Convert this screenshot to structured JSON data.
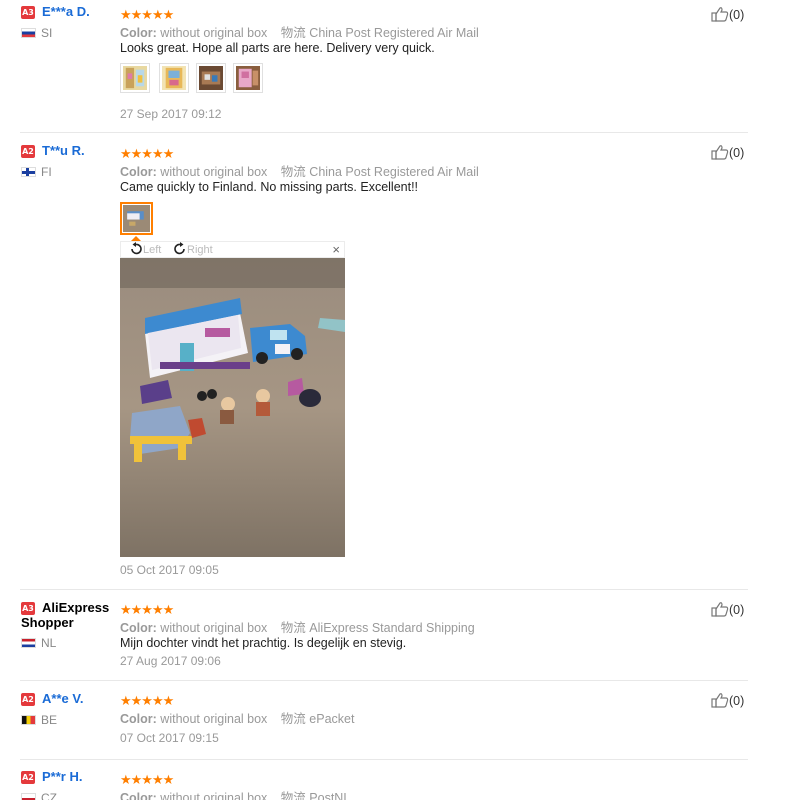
{
  "reviews": [
    {
      "level": "A3",
      "name": "E***a D.",
      "country": "SI",
      "stars": "★★★★★",
      "color_label": "Color:",
      "color_value": "without original box",
      "shipping_label": "物流",
      "shipping_value": "China Post Registered Air Mail",
      "text": "Looks great. Hope all parts are here. Delivery very quick.",
      "date": "27 Sep 2017 09:12",
      "helpful": "(0)",
      "photo_count": 4
    },
    {
      "level": "A2",
      "name": "T**u R.",
      "country": "FI",
      "stars": "★★★★★",
      "color_label": "Color:",
      "color_value": "without original box",
      "shipping_label": "物流",
      "shipping_value": "China Post Registered Air Mail",
      "text": "Came quickly to Finland. No missing parts. Excellent!!",
      "date": "05 Oct 2017 09:05",
      "helpful": "(0)",
      "photo_count": 1,
      "viewer": {
        "rotate_left": "Left",
        "rotate_right": "Right",
        "close": "×"
      }
    },
    {
      "level": "A3",
      "name": "AliExpress Shopper",
      "country": "NL",
      "stars": "★★★★★",
      "color_label": "Color:",
      "color_value": "without original box",
      "shipping_label": "物流",
      "shipping_value": "AliExpress Standard Shipping",
      "text": "Mijn dochter vindt het prachtig. Is degelijk en stevig.",
      "date": "27 Aug 2017 09:06",
      "helpful": "(0)"
    },
    {
      "level": "A2",
      "name": "A**e V.",
      "country": "BE",
      "stars": "★★★★★",
      "color_label": "Color:",
      "color_value": "without original box",
      "shipping_label": "物流",
      "shipping_value": "ePacket",
      "text": "",
      "date": "07 Oct 2017 09:15",
      "helpful": "(0)"
    },
    {
      "level": "A2",
      "name": "P**r H.",
      "country": "CZ",
      "stars": "★★★★★",
      "color_label": "Color:",
      "color_value": "without original box",
      "shipping_label": "物流",
      "shipping_value": "PostNL",
      "helpful": ""
    }
  ],
  "icons": {
    "thumbs_up": "thumbs-up-icon",
    "rotate_left": "rotate-left-icon",
    "rotate_right": "rotate-right-icon",
    "close": "close-icon"
  },
  "colors": {
    "level_badge": "#e4393c",
    "name_link": "#1a6bd6",
    "star": "#ff7f00",
    "active_thumb_border": "#ff7f00",
    "muted_text": "#999999"
  }
}
